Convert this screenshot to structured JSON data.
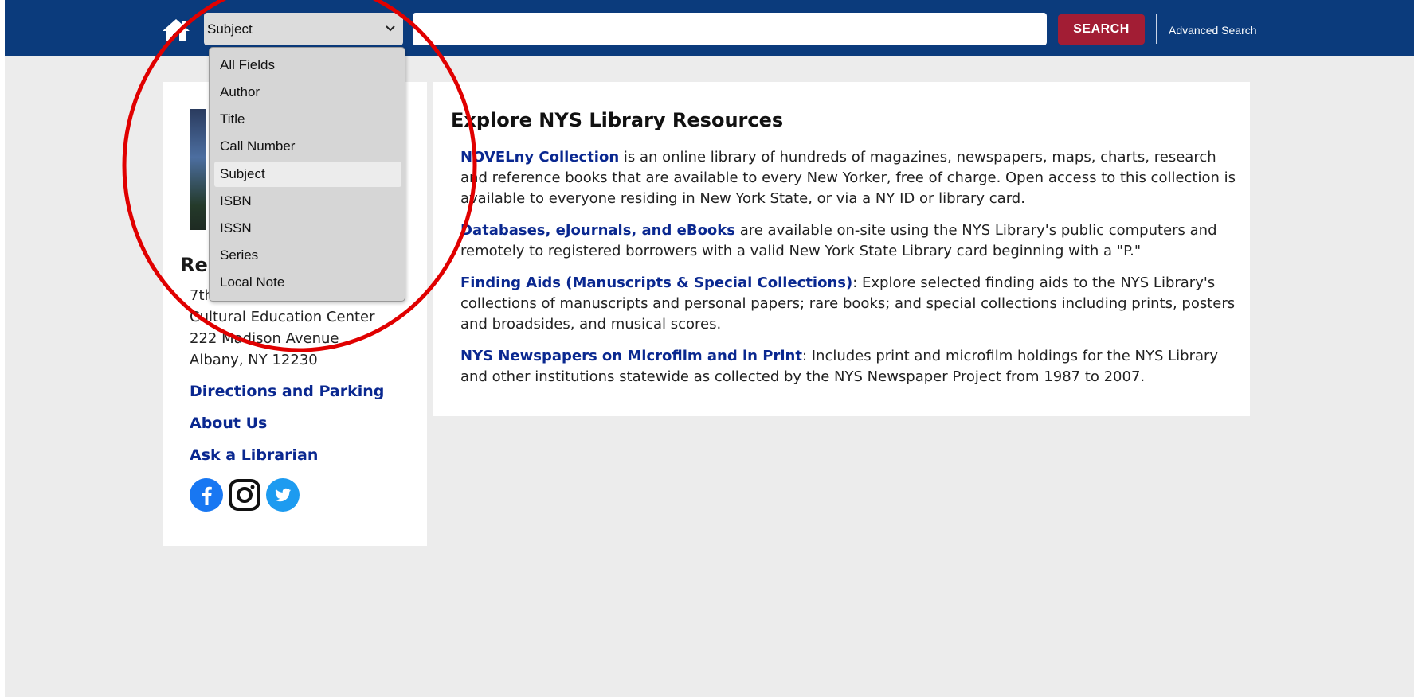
{
  "header": {
    "banner_fragment": "",
    "search_scope_selected": "Subject",
    "search_input_value": "",
    "search_button_label": "SEARCH",
    "advanced_search_label": "Advanced Search",
    "home_icon": "home-icon",
    "chevron_icon": "chevron-down-icon"
  },
  "dropdown": {
    "options": [
      "All Fields",
      "Author",
      "Title",
      "Call Number",
      "Subject",
      "ISBN",
      "ISSN",
      "Series",
      "Local Note"
    ],
    "selected_index": 4
  },
  "sidebar": {
    "heading_fragment": "Re",
    "address": [
      "7th Floor",
      "Cultural Education Center",
      "222 Madison Avenue",
      "Albany, NY 12230"
    ],
    "links": [
      "Directions and Parking",
      "About Us",
      "Ask a Librarian"
    ],
    "social_icons": [
      "facebook-icon",
      "instagram-icon",
      "twitter-icon"
    ]
  },
  "main": {
    "title": "Explore NYS Library Resources",
    "paragraphs": [
      {
        "link": "NOVELny Collection",
        "text": " is an online library of hundreds of magazines, newspapers, maps, charts, research and reference books that are available to every New Yorker, free of charge. Open access to this collection is available to everyone residing in New York State, or via a NY ID or library card."
      },
      {
        "link": "Databases, eJournals, and eBooks",
        "text": " are available on-site using the NYS Library's public computers and remotely to registered borrowers with a valid New York State Library card beginning with a \"P.\""
      },
      {
        "link": "Finding Aids (Manuscripts & Special Collections)",
        "text": ": Explore selected finding aids to the NYS Library's collections of manuscripts and personal papers; rare books; and special collections including prints, posters and broadsides, and musical scores."
      },
      {
        "link": "NYS Newspapers on Microfilm and in Print",
        "text": ": Includes print and microfilm holdings for the NYS Library and other institutions statewide as collected by the NYS Newspaper Project from 1987 to 2007."
      }
    ]
  },
  "colors": {
    "header_bg": "#0b3b7c",
    "search_button": "#a21d34",
    "link": "#0a2890",
    "annotation": "#e00000"
  }
}
